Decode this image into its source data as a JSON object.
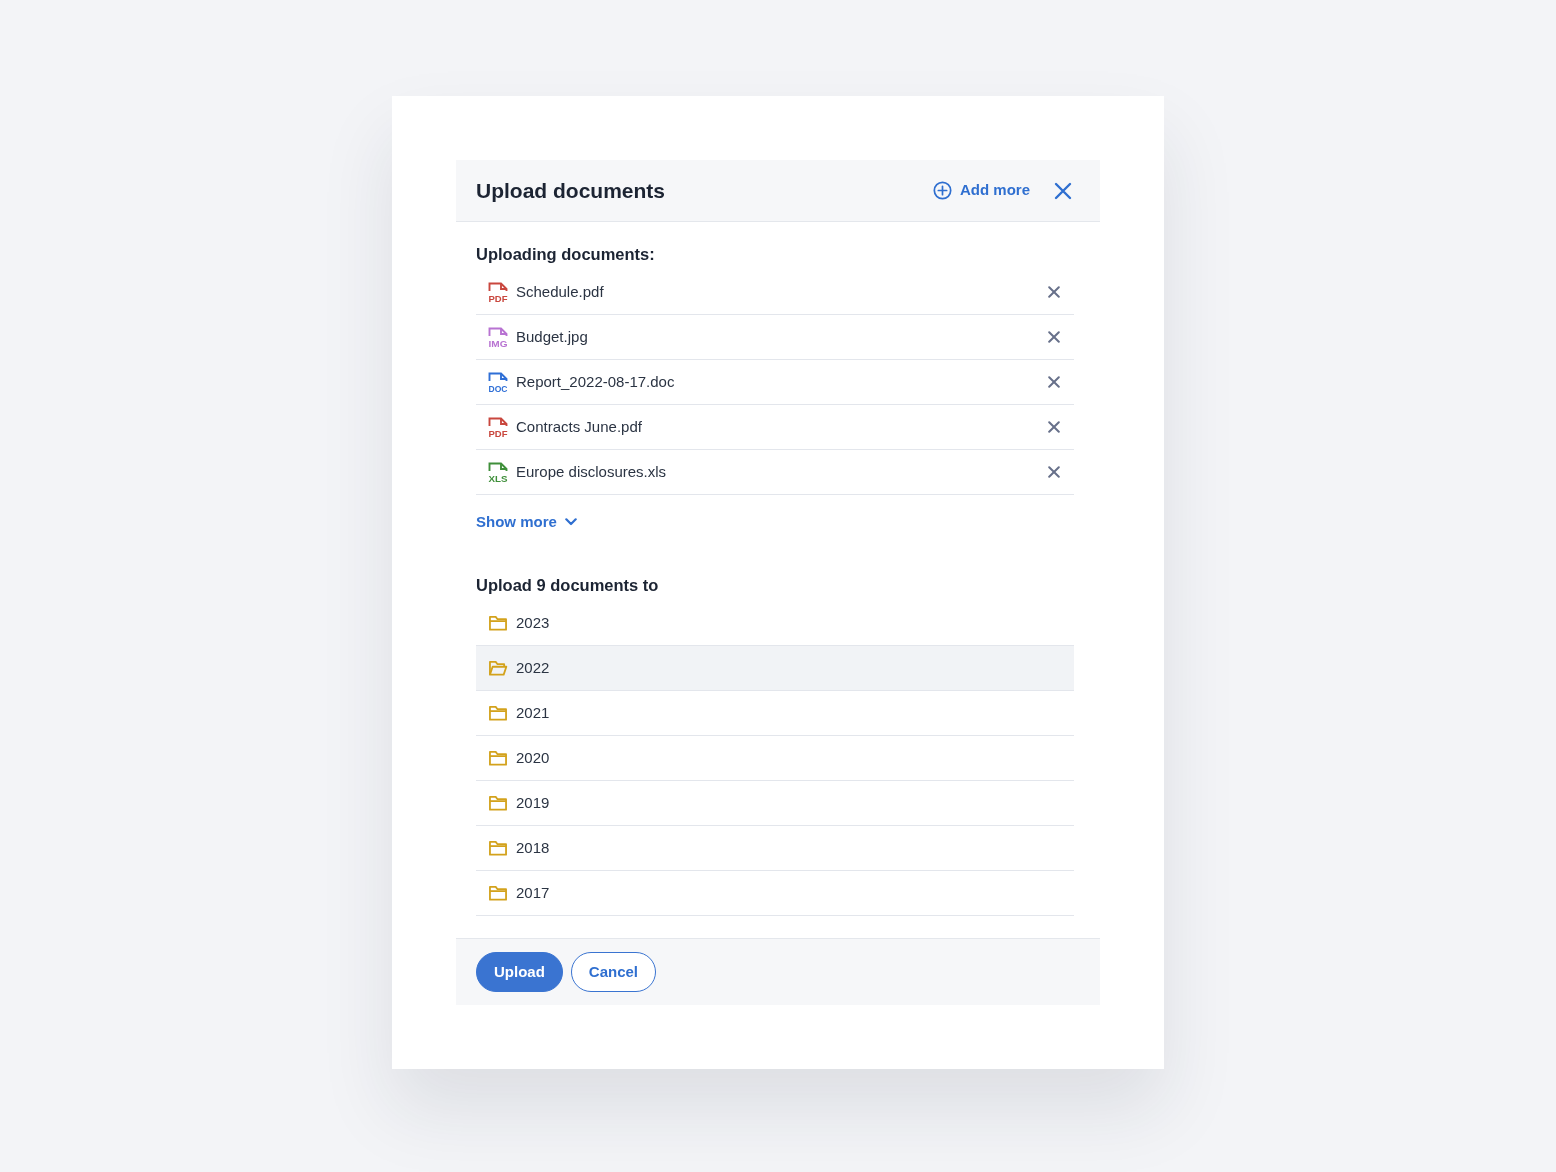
{
  "dialog": {
    "title": "Upload documents",
    "add_more": "Add more"
  },
  "uploading": {
    "heading": "Uploading documents:",
    "files": [
      {
        "name": "Schedule.pdf",
        "type_label": "PDF",
        "color": "#c9473e"
      },
      {
        "name": "Budget.jpg",
        "type_label": "IMG",
        "color": "#b873d2"
      },
      {
        "name": "Report_2022-08-17.doc",
        "type_label": "DOC",
        "color": "#2f6fd6"
      },
      {
        "name": "Contracts June.pdf",
        "type_label": "PDF",
        "color": "#c9473e"
      },
      {
        "name": "Europe disclosures.xls",
        "type_label": "XLS",
        "color": "#3f8f3a"
      }
    ],
    "show_more": {
      "label": "Show more",
      "expanded": false
    }
  },
  "destination": {
    "heading": "Upload 9 documents to",
    "folders": [
      {
        "name": "2023",
        "selected": false
      },
      {
        "name": "2022",
        "selected": true
      },
      {
        "name": "2021",
        "selected": false
      },
      {
        "name": "2020",
        "selected": false
      },
      {
        "name": "2019",
        "selected": false
      },
      {
        "name": "2018",
        "selected": false
      },
      {
        "name": "2017",
        "selected": false
      }
    ]
  },
  "buttons": [
    {
      "label": "Upload",
      "kind": "primary"
    },
    {
      "label": "Cancel",
      "kind": "secondary"
    }
  ]
}
